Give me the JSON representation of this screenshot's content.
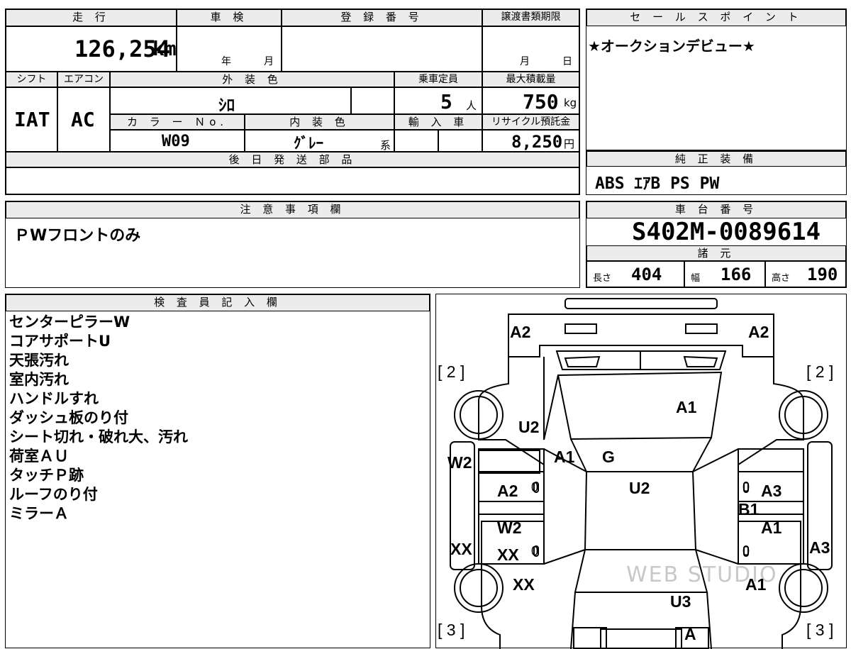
{
  "top": {
    "mileage_header": "走 行",
    "mileage_value": "126,254",
    "mileage_unit": "km",
    "shaken_header": "車 検",
    "shaken_year": "年",
    "shaken_month": "月",
    "registration_header": "登 録 番 号",
    "transfer_header": "譲渡書類期限",
    "transfer_month": "月",
    "transfer_day": "日",
    "shift_header": "シフト",
    "shift_value": "IAT",
    "ac_header": "エアコン",
    "ac_value": "AC",
    "exterior_header": "外 装 色",
    "exterior_value": "ｼﾛ",
    "capacity_header": "乗車定員",
    "capacity_value": "5",
    "capacity_unit": "人",
    "maxload_header": "最大積載量",
    "maxload_value": "750",
    "maxload_unit": "kg",
    "color_no_header": "カ ラ ー Ｎo.",
    "color_no_value": "W09",
    "interior_header": "内 装 色",
    "interior_value": "ｸﾞﾚｰ",
    "interior_suffix": "系",
    "import_header": "輸 入 車",
    "recycle_header": "リサイクル預託金",
    "recycle_value": "8,250",
    "recycle_unit": "円",
    "later_parts_header": "後 日 発 送 部 品"
  },
  "sales": {
    "header": "セ ー ル ス ポ イ ン ト",
    "text": "★オークションデビュー★"
  },
  "equipment": {
    "header": "純 正 装 備",
    "value": "ABS ｴｱB PS PW"
  },
  "caution": {
    "header": "注 意 事 項 欄",
    "text": "ＰWフロントのみ"
  },
  "chassis": {
    "header": "車 台 番 号",
    "value": "S402M-0089614",
    "spec_header": "諸 元",
    "length_label": "長さ",
    "length_value": "404",
    "width_label": "幅",
    "width_value": "166",
    "height_label": "高さ",
    "height_value": "190"
  },
  "inspector": {
    "header": "検 査 員 記 入 欄",
    "notes": [
      "センターピラーW",
      "コアサポートU",
      "天張汚れ",
      "室内汚れ",
      "ハンドルすれ",
      "ダッシュ板のり付",
      "シート切れ・破れ大、汚れ",
      "荷室ＡＵ",
      "タッチＰ跡",
      "ルーフのり付",
      "ミラーＡ"
    ]
  },
  "diagram": {
    "marks": {
      "front_left": "A2",
      "front_right": "A2",
      "tire_fl": "[ 2 ]",
      "tire_fr": "[ 2 ]",
      "tire_rl": "[ 3 ]",
      "tire_rr": "[ 3 ]",
      "hood": "A1",
      "fender_left": "U2",
      "pillar_left": "A1",
      "windshield": "G",
      "roof": "U2",
      "left_rocker": "W2",
      "left_front_door": "A2",
      "left_rear_door": "W2",
      "left_rear_door_2": "XX",
      "left_quarter": "XX",
      "left_rear_fender": "XX",
      "right_front_door": "A3",
      "right_pillar": "B1",
      "right_rear_door": "A1",
      "right_quarter": "A3",
      "right_rear_fender": "A1",
      "rear_gate": "U3",
      "rear_bumper": "A",
      "zero": "0"
    },
    "watermark": "WEB STUDIO"
  }
}
